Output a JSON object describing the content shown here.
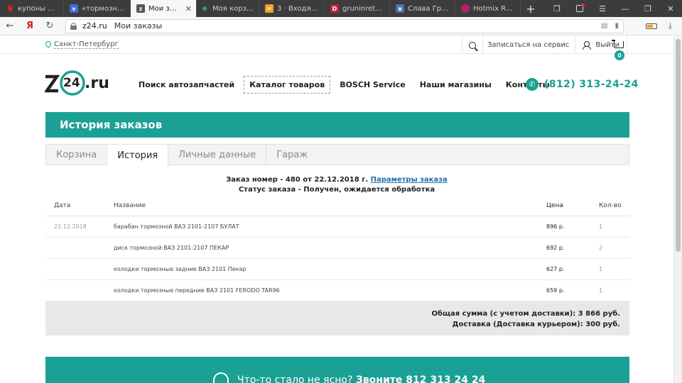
{
  "browser": {
    "tabs": [
      {
        "title": "купоны магазин",
        "favicon": "yandex-icon",
        "color": "#e22"
      },
      {
        "title": "«тормозные д",
        "favicon": "blue-v-icon",
        "color": "#3a6fd8"
      },
      {
        "title": "Мои заказы",
        "favicon": "site-icon",
        "color": "#555",
        "active": true
      },
      {
        "title": "Моя корзина",
        "favicon": "dot-icon",
        "color": "#1aa095"
      },
      {
        "title": "3 · Входящие –",
        "favicon": "mail-icon",
        "color": "#f0a020"
      },
      {
        "title": "gruninretro, Са",
        "favicon": "d-icon",
        "color": "#c0223a"
      },
      {
        "title": "Слава Грунин",
        "favicon": "vk-icon",
        "color": "#4a76a8"
      },
      {
        "title": "Hotmix Radio 8",
        "favicon": "radio-icon",
        "color": "#b0226a"
      }
    ],
    "new_tab": "+",
    "url_domain": "z24.ru",
    "url_title": "Мои заказы"
  },
  "topbar": {
    "city": "Санкт-Петербург",
    "service": "Записаться на сервис",
    "login": "Выйти",
    "cart_count": "0"
  },
  "logo": {
    "text": "24",
    "suffix": ".ru"
  },
  "nav": {
    "items": [
      "Поиск автозапчастей",
      "Каталог товаров",
      "BOSCH Service",
      "Наши магазины",
      "Контакты"
    ],
    "phone": "(812) 313-24-24"
  },
  "page_title": "История заказов",
  "tabs": [
    "Корзина",
    "История",
    "Личные данные",
    "Гараж"
  ],
  "order": {
    "line1": "Заказ номер - 480 от 22.12.2018 г.",
    "link": "Параметры заказа",
    "status": "Статус заказа - Получен, ожидается обработка"
  },
  "table": {
    "headers": {
      "date": "Дата",
      "name": "Название",
      "price": "Цена",
      "qty": "Кол-во"
    },
    "rows": [
      {
        "date": "22.12.2018",
        "name": "барабан тормозной ВАЗ 2101-2107 БУЛАТ",
        "price": "896 р.",
        "qty": "1"
      },
      {
        "date": "",
        "name": "диск тормозной ВАЗ 2101-2107 ПЕКАР",
        "price": "692 р.",
        "qty": "2"
      },
      {
        "date": "",
        "name": "колодки тормозные задние ВАЗ 2101 Пекар",
        "price": "627 р.",
        "qty": "1"
      },
      {
        "date": "",
        "name": "колодки тормозные передние ВАЗ 2101 FERODO TAR96",
        "price": "659 р.",
        "qty": "1"
      }
    ]
  },
  "totals": {
    "sum": "Общая сумма (с учетом доставки): 3 866 руб.",
    "delivery": "Доставка (Доставка курьером): 300 руб."
  },
  "footer": {
    "text": "Что-то стало не ясно?",
    "phone": "Звоните 812 313 24 24"
  },
  "colors": {
    "accent": "#1aa095",
    "link": "#1f6fa8"
  }
}
